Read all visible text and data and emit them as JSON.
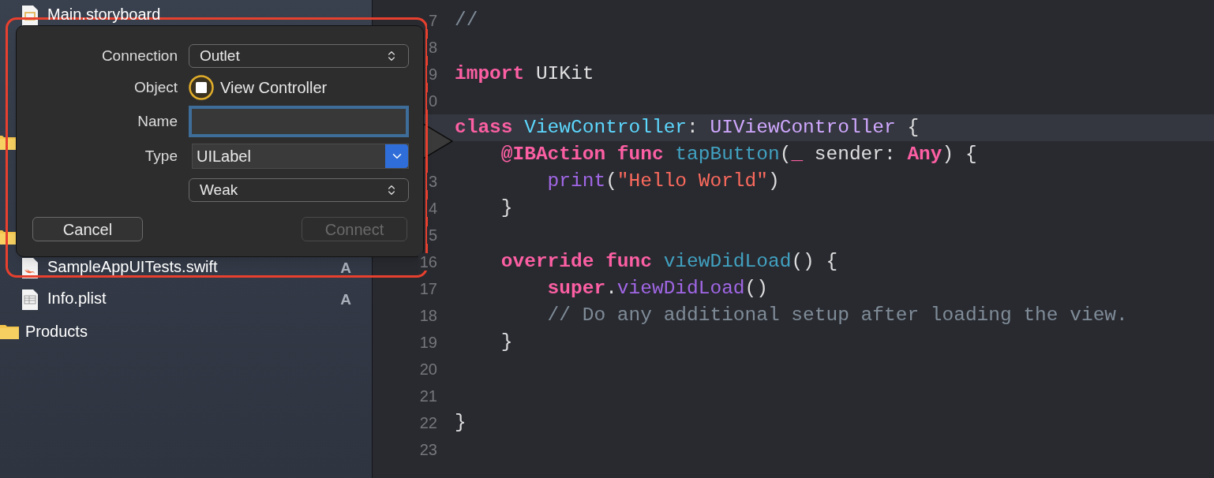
{
  "sidebar": {
    "items": [
      {
        "kind": "storyboard",
        "name": "Main.storyboard"
      },
      {
        "kind": "covered"
      },
      {
        "kind": "covered"
      },
      {
        "kind": "covered"
      },
      {
        "kind": "folder"
      },
      {
        "kind": "covered"
      },
      {
        "kind": "covered"
      },
      {
        "kind": "folder"
      },
      {
        "kind": "swift",
        "name": "SampleAppUITests.swift",
        "badge": "A"
      },
      {
        "kind": "plist",
        "name": "Info.plist",
        "badge": "A"
      },
      {
        "kind": "group",
        "name": "Products"
      }
    ]
  },
  "editor": {
    "lines": [
      {
        "number": "7",
        "current": false,
        "tokens": [
          {
            "kind": "comment",
            "text": "//"
          }
        ]
      },
      {
        "number": "8",
        "current": false
      },
      {
        "number": "9",
        "current": false,
        "tokens": [
          {
            "kind": "keyword",
            "text": "import"
          },
          {
            "kind": "plain",
            "text": " UIKit"
          }
        ]
      },
      {
        "number": "0",
        "current": false
      },
      {
        "current": true,
        "tokens": [
          {
            "kind": "keyword",
            "text": "class"
          },
          {
            "kind": "declaration",
            "text": " ViewController"
          },
          {
            "kind": "plain",
            "text": ":"
          },
          {
            "kind": "type",
            "text": " UIViewController"
          },
          {
            "kind": "plain",
            "text": " {"
          }
        ]
      },
      {
        "current": false,
        "tokens": [
          {
            "kind": "keyword",
            "text": "    @IBAction"
          },
          {
            "kind": "keyword",
            "text": " func"
          },
          {
            "kind": "function",
            "text": " tapButton"
          },
          {
            "kind": "plain",
            "text": "("
          },
          {
            "kind": "keyword",
            "text": "_"
          },
          {
            "kind": "plain",
            "text": " sender:"
          },
          {
            "kind": "keyword",
            "text": " Any"
          },
          {
            "kind": "plain",
            "text": ") {"
          }
        ]
      },
      {
        "number": "3",
        "current": false,
        "tokens": [
          {
            "kind": "call",
            "text": "        print"
          },
          {
            "kind": "plain",
            "text": "("
          },
          {
            "kind": "string",
            "text": "\"Hello World\""
          },
          {
            "kind": "plain",
            "text": ")"
          }
        ]
      },
      {
        "number": "4",
        "current": false,
        "tokens": [
          {
            "kind": "plain",
            "text": "    }"
          }
        ]
      },
      {
        "number": "5",
        "current": false
      },
      {
        "number": "16",
        "current": false,
        "tokens": [
          {
            "kind": "keyword",
            "text": "    override"
          },
          {
            "kind": "keyword",
            "text": " func"
          },
          {
            "kind": "function",
            "text": " viewDidLoad"
          },
          {
            "kind": "plain",
            "text": "() {"
          }
        ]
      },
      {
        "number": "17",
        "current": false,
        "tokens": [
          {
            "kind": "keyword",
            "text": "        super"
          },
          {
            "kind": "plain",
            "text": "."
          },
          {
            "kind": "call",
            "text": "viewDidLoad"
          },
          {
            "kind": "plain",
            "text": "()"
          }
        ]
      },
      {
        "number": "18",
        "current": false,
        "tokens": [
          {
            "kind": "comment",
            "text": "        // Do any additional setup after loading the view."
          }
        ]
      },
      {
        "number": "19",
        "current": false,
        "tokens": [
          {
            "kind": "plain",
            "text": "    }"
          }
        ]
      },
      {
        "number": "20",
        "current": false
      },
      {
        "number": "21",
        "current": false
      },
      {
        "number": "22",
        "current": false,
        "tokens": [
          {
            "kind": "plain",
            "text": "}"
          }
        ]
      },
      {
        "number": "23",
        "current": false
      }
    ]
  },
  "connection_popover": {
    "connection": {
      "label": "Connection",
      "value": "Outlet"
    },
    "object": {
      "label": "Object",
      "value": "View Controller"
    },
    "name": {
      "label": "Name",
      "focused": true
    },
    "type": {
      "label": "Type",
      "value": "UILabel"
    },
    "storage": {
      "value": "Weak"
    },
    "buttons": [
      {
        "label": "Cancel",
        "disabled": false
      },
      {
        "label": "Connect",
        "disabled": true
      }
    ]
  }
}
